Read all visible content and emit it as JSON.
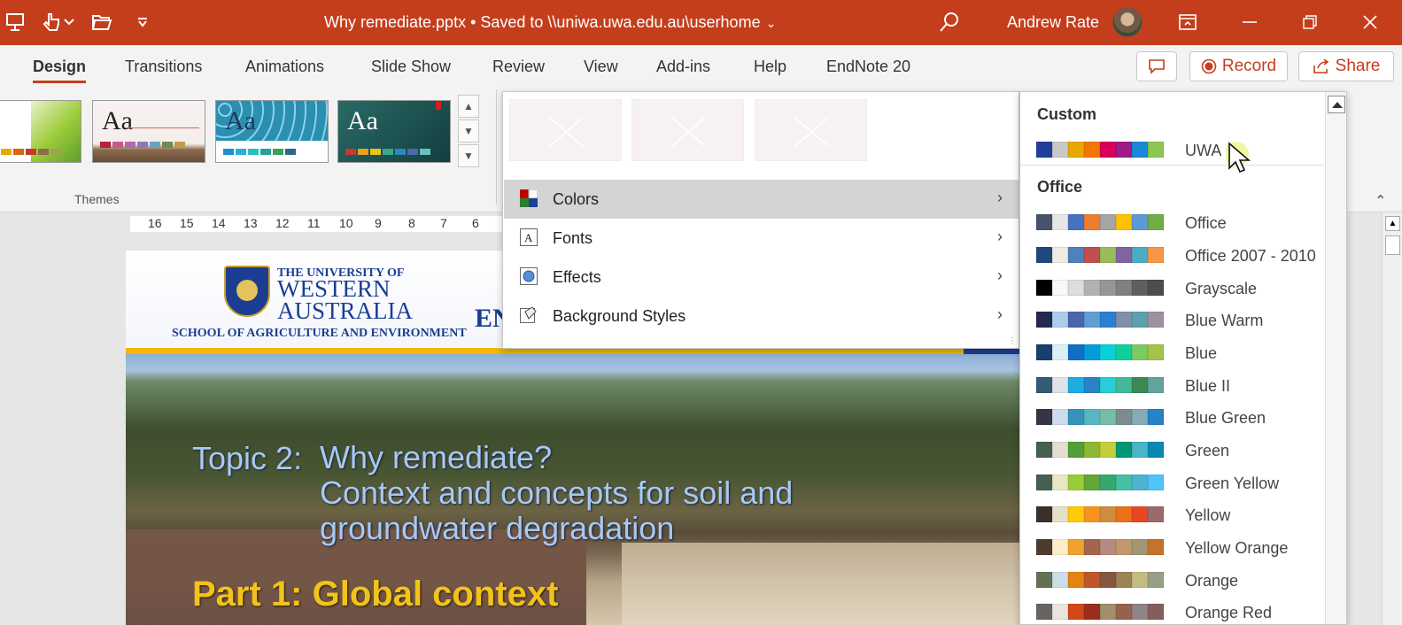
{
  "window": {
    "title": "Why remediate.pptx • Saved to \\\\uniwa.uwa.edu.au\\userhome",
    "user": "Andrew Rate"
  },
  "tabs": [
    {
      "label": "Design",
      "active": true
    },
    {
      "label": "Transitions"
    },
    {
      "label": "Animations"
    },
    {
      "label": "Slide Show"
    },
    {
      "label": "Review"
    },
    {
      "label": "View"
    },
    {
      "label": "Add-ins"
    },
    {
      "label": "Help"
    },
    {
      "label": "EndNote 20"
    }
  ],
  "actions": {
    "record": "Record",
    "share": "Share"
  },
  "ribbon": {
    "group_label": "Themes",
    "themes": [
      {
        "aa": "",
        "bg": "#ffffff",
        "strip": [
          "#e5a800",
          "#d86613",
          "#c9382a",
          "#8a6e4b",
          "#9aa84a"
        ]
      },
      {
        "aa": "Aa",
        "bg": "#f4eeec",
        "strip": [
          "#b8223a",
          "#c85a8a",
          "#b06ab0",
          "#8a7ab8",
          "#6aa0c8",
          "#6c8c4a",
          "#c49a4a"
        ]
      },
      {
        "aa": "Aa",
        "bg": "#2a8fb0",
        "strip": [
          "#1f8fd0",
          "#29b0d8",
          "#26c0c0",
          "#2aa090",
          "#3aa05a",
          "#2a6a8a"
        ]
      },
      {
        "aa": "Aa",
        "bg": "#1e5a5a",
        "strip": [
          "#c43c2c",
          "#e8a020",
          "#e8c020",
          "#3aa88a",
          "#2a8ac0",
          "#4a6ab0",
          "#6ac0c0"
        ]
      }
    ]
  },
  "ruler": [
    "16",
    "15",
    "14",
    "13",
    "12",
    "11",
    "10",
    "9",
    "8",
    "7",
    "6"
  ],
  "slide": {
    "uni_small": "THE UNIVERSITY OF",
    "uni_line1": "WESTERN",
    "uni_line2": "AUSTRALIA",
    "school": "SCHOOL OF AGRICULTURE AND ENVIRONMENT",
    "header_fragment": "EN",
    "topic_label": "Topic 2:",
    "topic_lines": [
      "Why remediate?",
      "Context and concepts for soil and",
      "groundwater degradation"
    ],
    "part": "Part 1: Global context"
  },
  "variants_menu": {
    "items": [
      {
        "label": "Colors",
        "icon": "colors-icon",
        "hover": true
      },
      {
        "label": "Fonts",
        "icon": "fonts-icon"
      },
      {
        "label": "Effects",
        "icon": "effects-icon"
      },
      {
        "label": "Background Styles",
        "icon": "background-styles-icon"
      }
    ]
  },
  "colors_panel": {
    "custom_heading": "Custom",
    "office_heading": "Office",
    "custom": [
      {
        "name": "UWA",
        "swatches": [
          "#1f3f99",
          "#c8c8c8",
          "#e8a800",
          "#f07800",
          "#d8005a",
          "#a01a8a",
          "#1a88d8",
          "#8ac850"
        ]
      }
    ],
    "office": [
      {
        "name": "Office",
        "swatches": [
          "#44546a",
          "#e7e6e6",
          "#4472c4",
          "#ed7d31",
          "#a5a5a5",
          "#ffc000",
          "#5b9bd5",
          "#70ad47"
        ]
      },
      {
        "name": "Office 2007 - 2010",
        "swatches": [
          "#1f497d",
          "#eeece1",
          "#4f81bd",
          "#c0504d",
          "#9bbb59",
          "#8064a2",
          "#4bacc6",
          "#f79646"
        ]
      },
      {
        "name": "Grayscale",
        "swatches": [
          "#000000",
          "#f8f8f8",
          "#dddddd",
          "#b2b2b2",
          "#969696",
          "#808080",
          "#5f5f5f",
          "#4d4d4d"
        ]
      },
      {
        "name": "Blue Warm",
        "swatches": [
          "#242852",
          "#acccea",
          "#4a66ac",
          "#629dd1",
          "#297fd5",
          "#7f8fa9",
          "#5aa2ae",
          "#9d90a0"
        ]
      },
      {
        "name": "Blue",
        "swatches": [
          "#17406d",
          "#dbeff9",
          "#0f6fc6",
          "#009dd9",
          "#0bd0d9",
          "#10cf9b",
          "#7cca62",
          "#a5c249"
        ]
      },
      {
        "name": "Blue II",
        "swatches": [
          "#335b74",
          "#dfe3e5",
          "#1cade4",
          "#2683c6",
          "#27ced7",
          "#42ba97",
          "#3e8853",
          "#62a39f"
        ]
      },
      {
        "name": "Blue Green",
        "swatches": [
          "#373545",
          "#ceddec",
          "#3494ba",
          "#58b6c0",
          "#75bda7",
          "#7a8c8e",
          "#84acb6",
          "#2683c6"
        ]
      },
      {
        "name": "Green",
        "swatches": [
          "#455f51",
          "#e3ded1",
          "#549e39",
          "#8ab833",
          "#c0cf3a",
          "#029676",
          "#4ab5c4",
          "#0989b1"
        ]
      },
      {
        "name": "Green Yellow",
        "swatches": [
          "#455f51",
          "#e5e8c0",
          "#99cb38",
          "#63a537",
          "#37a76f",
          "#44c1a3",
          "#4eb3cf",
          "#51c3f9"
        ]
      },
      {
        "name": "Yellow",
        "swatches": [
          "#39302a",
          "#e5dec8",
          "#ffca08",
          "#f8931d",
          "#ce8d3e",
          "#ec7016",
          "#e64823",
          "#9c6a6a"
        ]
      },
      {
        "name": "Yellow Orange",
        "swatches": [
          "#4e3b30",
          "#fbeec9",
          "#f0a22e",
          "#a5644e",
          "#b58b80",
          "#c3986d",
          "#a19574",
          "#c17529"
        ]
      },
      {
        "name": "Orange",
        "swatches": [
          "#637052",
          "#ccddea",
          "#e48312",
          "#bd582c",
          "#865640",
          "#9b8357",
          "#c2bc80",
          "#94a088"
        ]
      },
      {
        "name": "Orange Red",
        "swatches": [
          "#696464",
          "#e9e5dc",
          "#d34817",
          "#9b2d1f",
          "#a28e6a",
          "#956251",
          "#918485",
          "#855d5d"
        ]
      }
    ]
  }
}
